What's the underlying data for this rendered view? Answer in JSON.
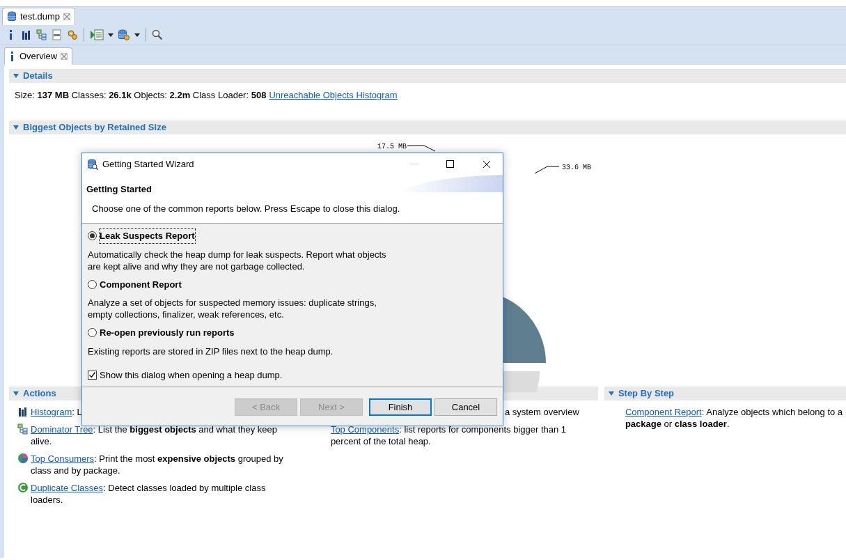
{
  "editor_tab": {
    "label": "test.dump",
    "selected": true
  },
  "overview_tab": {
    "label": "Overview",
    "selected": true
  },
  "details": {
    "title": "Details",
    "expanded": true,
    "stats": "Size: **137 MB** Classes: **26.1k** Objects: **2.2m** Class Loader: **508**",
    "link": "Unreachable Objects Histogram"
  },
  "biggest_objects": {
    "title": "Biggest Objects by Retained Size",
    "expanded": true,
    "pie_labels": [
      "17.5 MB",
      "33.6 MB"
    ]
  },
  "actions": {
    "title": "Actions",
    "expanded": true,
    "items": [
      {
        "kind": "histogram",
        "link": "Histogram",
        "text": ": L"
      },
      {
        "kind": "tree",
        "link": "Dominator Tree",
        "text": ": List the **biggest objects** and what they keep alive."
      },
      {
        "kind": "consumers",
        "link": "Top Consumers",
        "text": ": Print the most **expensive objects** grouped by class and by package."
      },
      {
        "kind": "duplicates",
        "link": "Duplicate Classes",
        "text": ": Detect classes loaded by multiple class loaders."
      }
    ]
  },
  "reports": {
    "items": [
      {
        "text": "a system overview"
      },
      {
        "link": "Top Components",
        "text": ": list reports for components bigger than 1 percent of the total heap."
      }
    ]
  },
  "step_by_step": {
    "title": "Step By Step",
    "expanded": true,
    "items": [
      {
        "link": "Component Report",
        "text": ": Analyze objects which belong to a **package** or **class loader**."
      }
    ]
  },
  "dialog": {
    "title": "Getting Started Wizard",
    "heading": "Getting Started",
    "description": "Choose one of the common reports below. Press Escape to close this dialog.",
    "options": [
      {
        "label": "Leak Suspects Report",
        "description": "Automatically check the heap dump for leak suspects. Report what objects are kept alive and why they are not garbage collected.",
        "selected": true
      },
      {
        "label": "Component Report",
        "description": "Analyze a set of objects for suspected memory issues: duplicate strings, empty collections, finalizer, weak references, etc.",
        "selected": false
      },
      {
        "label": "Re-open previously run reports",
        "description": "Existing reports are stored in ZIP files next to the heap dump.",
        "selected": false
      }
    ],
    "show_dialog": {
      "label": "Show this dialog when opening a heap dump.",
      "checked": true
    },
    "buttons": [
      {
        "label": "< Back",
        "disabled": true,
        "default": false
      },
      {
        "label": "Next >",
        "disabled": true,
        "default": false
      },
      {
        "label": "Finish",
        "disabled": false,
        "default": true
      },
      {
        "label": "Cancel",
        "disabled": false,
        "default": false
      }
    ]
  }
}
